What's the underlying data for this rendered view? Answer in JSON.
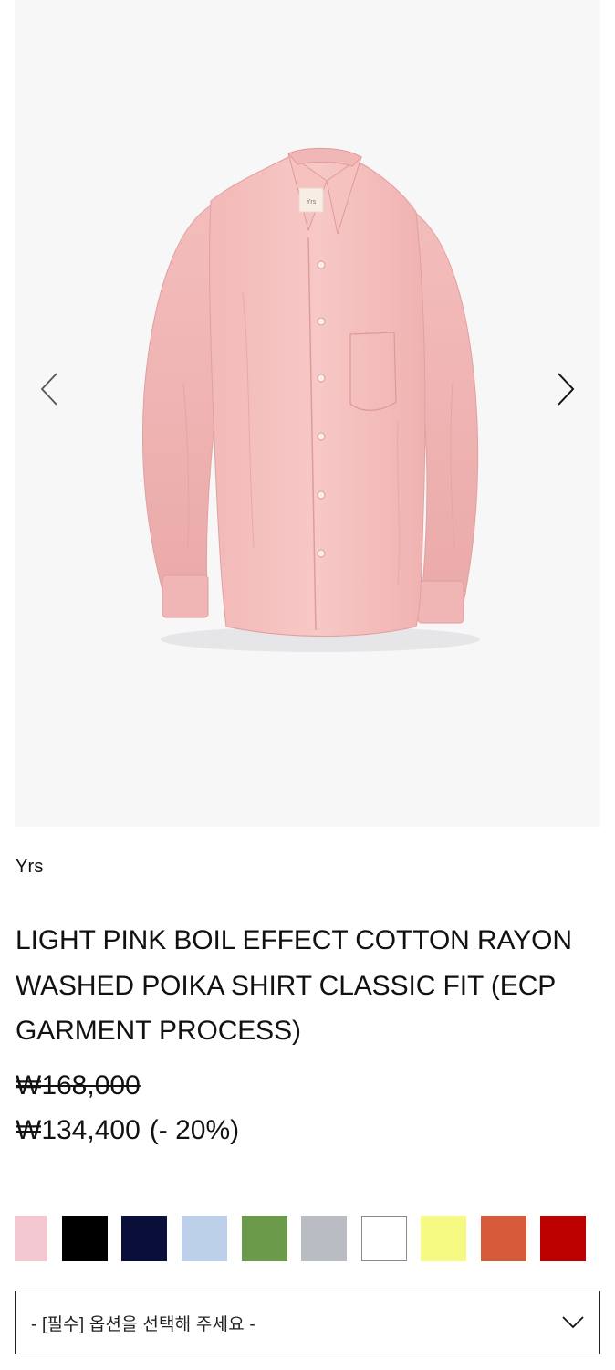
{
  "gallery": {
    "prev_icon": "chevron-left-icon",
    "next_icon": "chevron-right-icon",
    "label_tag_text": "Yrs"
  },
  "product": {
    "brand": "Yrs",
    "title": "LIGHT PINK BOIL EFFECT COTTON RAYON WASHED POIKA SHIRT CLASSIC FIT (ECP GARMENT PROCESS)",
    "original_price": "₩168,000",
    "sale_price": "₩134,400",
    "discount": "(- 20%)"
  },
  "colors": [
    "#f2c7cf",
    "#000000",
    "#0a0f3a",
    "#bcd0ea",
    "#6a9a4a",
    "#b9bcc2",
    "#ffffff",
    "#f7fa82",
    "#d6593a",
    "#bd0000"
  ],
  "option_select": {
    "placeholder": "- [필수] 옵션을 선택해 주세요 -",
    "icon": "chevron-down-icon"
  }
}
